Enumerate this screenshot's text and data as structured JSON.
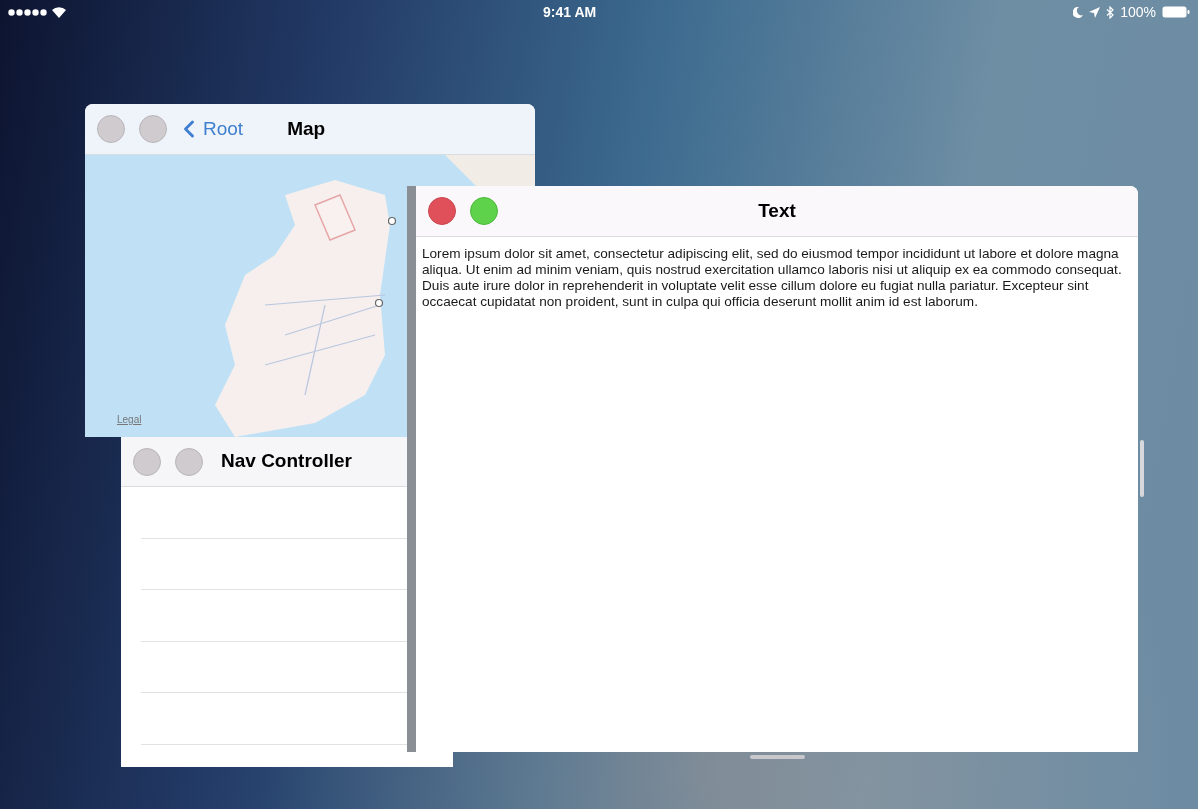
{
  "status_bar": {
    "time": "9:41 AM",
    "battery": "100%"
  },
  "windows": [
    {
      "kind": "map",
      "title": "Map",
      "back": "Root",
      "active": false,
      "legal": "Legal"
    },
    {
      "kind": "list",
      "title": "Nav Controller",
      "active": false
    },
    {
      "kind": "text",
      "title": "Text",
      "active": true,
      "body": "Lorem ipsum dolor sit amet, consectetur adipiscing elit, sed do eiusmod tempor incididunt ut labore et dolore magna aliqua. Ut enim ad minim veniam, quis nostrud exercitation ullamco laboris nisi ut aliquip ex ea commodo consequat. Duis aute irure dolor in reprehenderit in voluptate velit esse cillum dolore eu fugiat nulla pariatur. Excepteur sint occaecat cupidatat non proident, sunt in culpa qui officia deserunt mollit anim id est laborum."
    }
  ]
}
